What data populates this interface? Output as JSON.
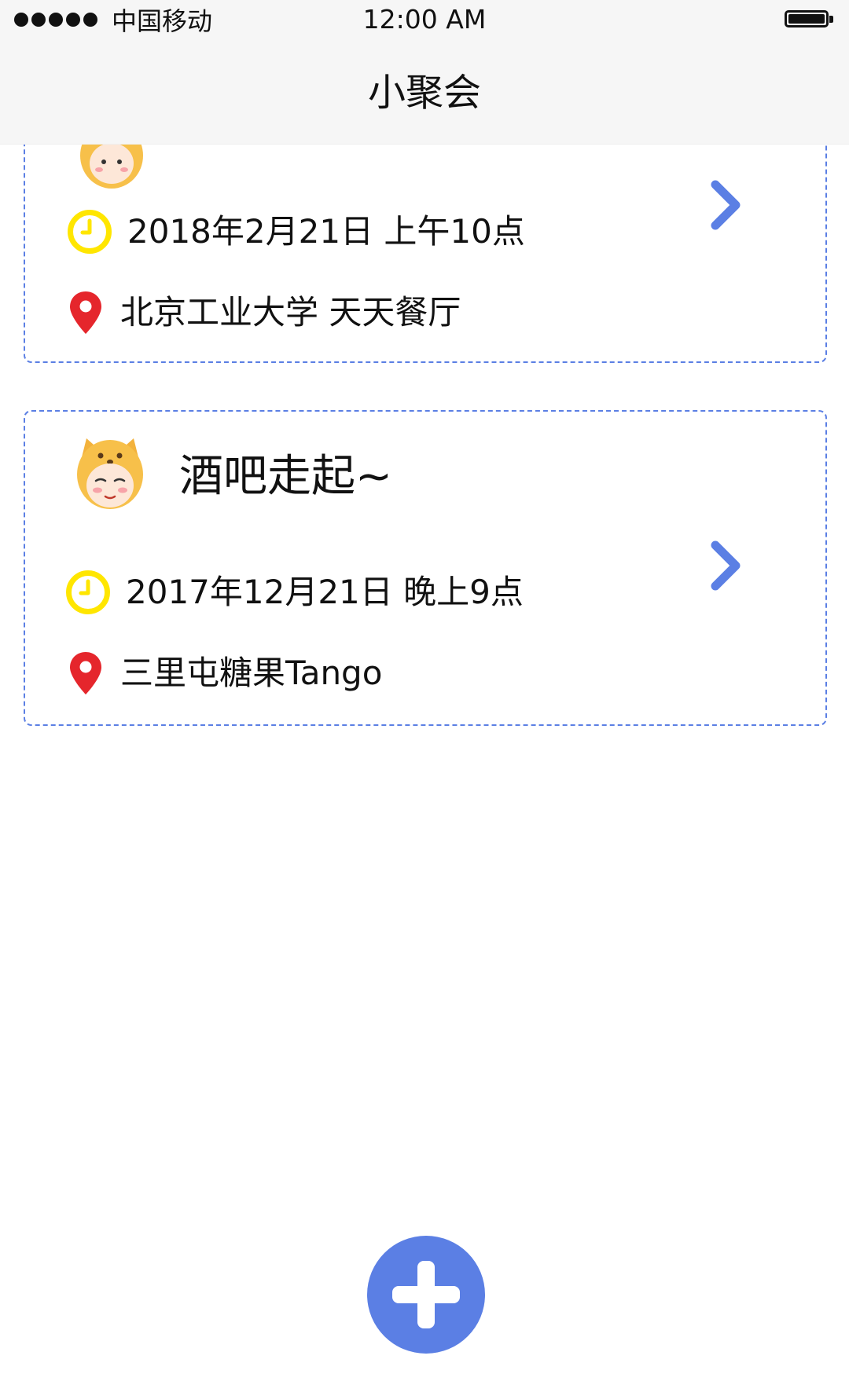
{
  "status_bar": {
    "carrier": "中国移动",
    "time": "12:00 AM"
  },
  "nav": {
    "title": "小聚会"
  },
  "events": [
    {
      "title": "",
      "datetime": "2018年2月21日 上午10点",
      "location": "北京工业大学 天天餐厅"
    },
    {
      "title": "酒吧走起~",
      "datetime": "2017年12月21日 晚上9点",
      "location": "三里屯糖果Tango"
    }
  ],
  "colors": {
    "accent": "#5b7fe4",
    "clock": "#ffe600",
    "pin": "#e5262c"
  },
  "icons": {
    "time": "clock-icon",
    "location": "location-pin-icon",
    "open": "chevron-right-icon",
    "add": "plus-icon"
  }
}
